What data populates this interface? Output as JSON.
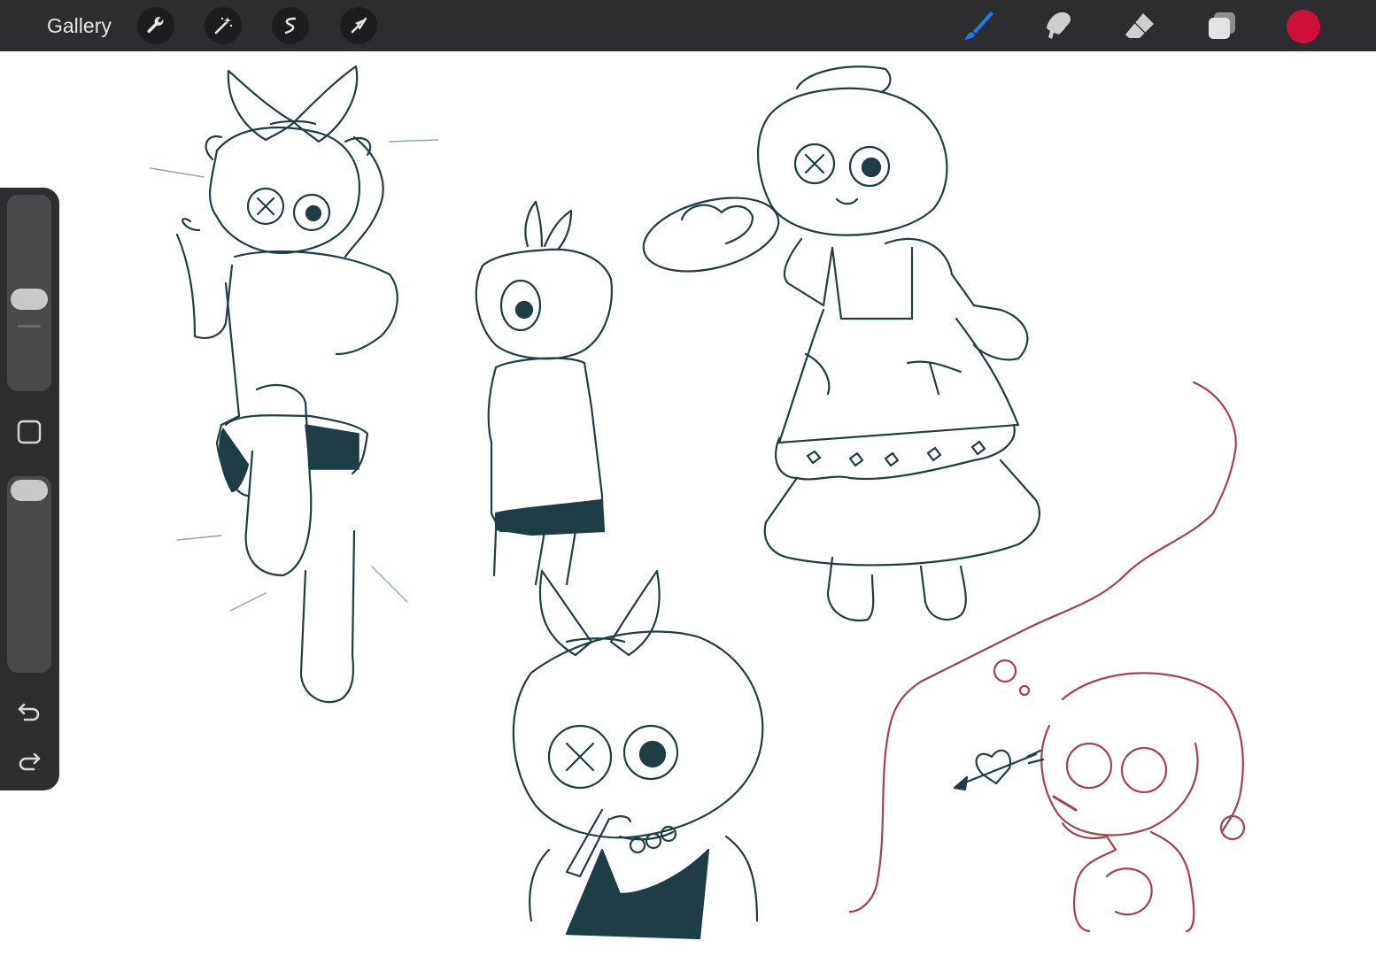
{
  "topbar": {
    "gallery_label": "Gallery",
    "left_tools": [
      "wrench-icon",
      "magic-wand-icon",
      "selection-icon",
      "transform-arrow-icon"
    ],
    "right_tools": [
      "brush-icon",
      "smudge-icon",
      "eraser-icon",
      "layers-icon"
    ],
    "active_tool": "brush-icon",
    "current_color": "#d0103a",
    "active_tool_color": "#1f7be8"
  },
  "sidebar": {
    "brush_size": 0.5,
    "brush_opacity": 0.95,
    "buttons": [
      "modify-square-icon",
      "undo-icon",
      "redo-icon"
    ]
  },
  "canvas": {
    "stroke_colors": {
      "teal_sketch": "#1e3d44",
      "pink_sketch": "#a2424f"
    }
  }
}
